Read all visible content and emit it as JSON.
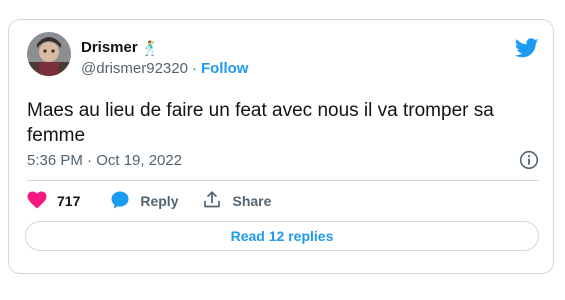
{
  "tweet": {
    "author_name": "Drismer",
    "author_emoji": "🕺",
    "handle": "@drismer92320",
    "separator": "·",
    "follow_label": "Follow",
    "text": "Maes au lieu de faire un feat avec nous il va tromper sa femme",
    "timestamp": "5:36 PM · Oct 19, 2022",
    "likes": "717",
    "reply_label": "Reply",
    "share_label": "Share",
    "read_replies_label": "Read 12 replies"
  },
  "colors": {
    "accent": "#1d9bf0",
    "like": "#f91880",
    "secondary_text": "#536471",
    "border": "#cfd9de"
  },
  "icons": [
    "twitter-bird-icon",
    "info-icon",
    "heart-icon",
    "reply-bubble-icon",
    "share-icon"
  ]
}
